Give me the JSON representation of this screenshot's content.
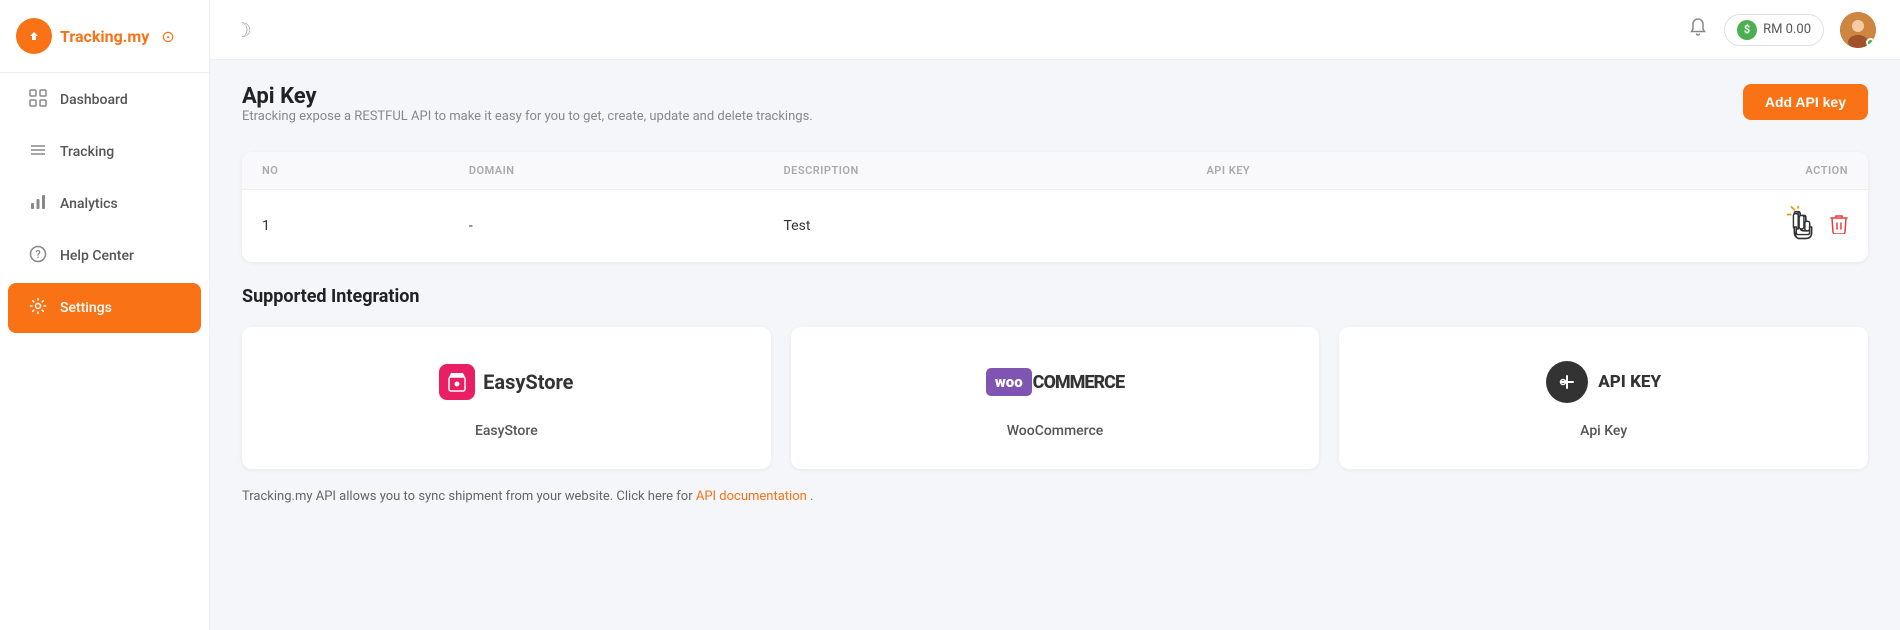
{
  "sidebar": {
    "logo": {
      "text": "Tracking.my",
      "badge": "⊙"
    },
    "items": [
      {
        "id": "dashboard",
        "label": "Dashboard",
        "icon": "⌂",
        "active": false
      },
      {
        "id": "tracking",
        "label": "Tracking",
        "icon": "≡",
        "active": false
      },
      {
        "id": "analytics",
        "label": "Analytics",
        "icon": "📊",
        "active": false
      },
      {
        "id": "help-center",
        "label": "Help Center",
        "icon": "◎",
        "active": false
      },
      {
        "id": "settings",
        "label": "Settings",
        "icon": "⚙",
        "active": true
      }
    ]
  },
  "topbar": {
    "moon_icon": "☽",
    "balance": "RM 0.00",
    "bell_icon": "🔔"
  },
  "page": {
    "title": "Api Key",
    "subtitle": "Etracking expose a RESTFUL API to make it easy for you to get, create, update and delete trackings.",
    "add_button_label": "Add API key"
  },
  "table": {
    "columns": [
      "NO",
      "DOMAIN",
      "DESCRIPTION",
      "API KEY",
      "ACTION"
    ],
    "rows": [
      {
        "no": "1",
        "domain": "-",
        "description": "Test",
        "api_key": ""
      }
    ]
  },
  "supported_integration": {
    "title": "Supported Integration",
    "cards": [
      {
        "id": "easystore",
        "name": "EasyStore"
      },
      {
        "id": "woocommerce",
        "name": "WooCommerce"
      },
      {
        "id": "apikey",
        "name": "Api Key"
      }
    ]
  },
  "footer": {
    "text": "Tracking.my API allows you to sync shipment from your website. Click here for",
    "link_text": "API documentation",
    "period": "."
  }
}
